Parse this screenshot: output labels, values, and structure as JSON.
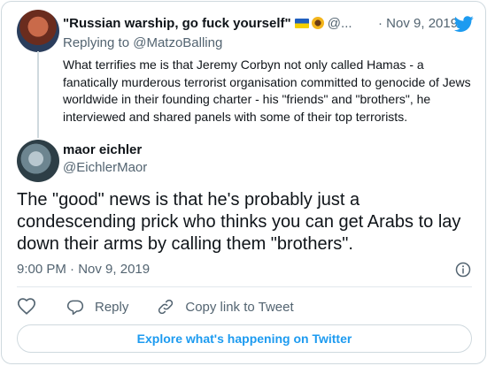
{
  "parent": {
    "display_name": "\"Russian warship, go fuck yourself\"",
    "handle_truncated": "@...",
    "separator": "·",
    "date": "Nov 9, 2019",
    "replying_prefix": "Replying to ",
    "replying_to": "@MatzoBalling",
    "text": "What terrifies me is that Jeremy Corbyn not only called Hamas - a fanatically murderous terrorist organisation committed to genocide of Jews worldwide in their founding charter - his \"friends\" and \"brothers\", he interviewed and shared panels with some of their top terrorists."
  },
  "reply": {
    "display_name": "maor eichler",
    "handle": "@EichlerMaor",
    "text": "The \"good\" news is that he's probably just a condescending prick who thinks you can get Arabs to lay down their arms by calling them \"brothers\".",
    "time": "9:00 PM",
    "separator": "·",
    "date": "Nov 9, 2019"
  },
  "actions": {
    "reply_label": "Reply",
    "copy_label": "Copy link to Tweet"
  },
  "explore_label": "Explore what's happening on Twitter",
  "colors": {
    "accent": "#1d9bf0",
    "muted": "#536471",
    "text": "#0f1419",
    "border": "#cfd9de"
  },
  "icons": [
    "twitter-bird-icon",
    "info-icon",
    "heart-icon",
    "reply-bubble-icon",
    "link-icon",
    "ukraine-flag-icon",
    "sunflower-icon"
  ]
}
